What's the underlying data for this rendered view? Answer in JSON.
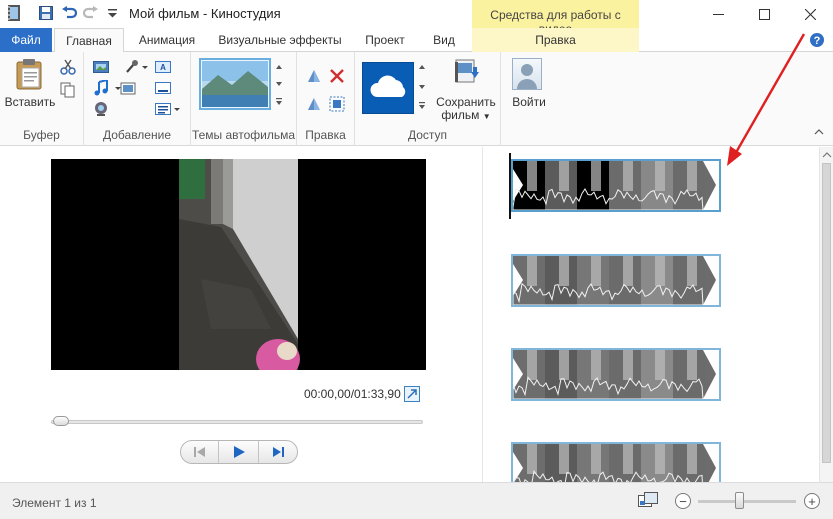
{
  "window": {
    "title": "Мой фильм - Киностудия",
    "contextual_tab_group": "Средства для работы с видео"
  },
  "tabs": [
    {
      "label": "Файл"
    },
    {
      "label": "Главная"
    },
    {
      "label": "Анимация"
    },
    {
      "label": "Визуальные эффекты"
    },
    {
      "label": "Проект"
    },
    {
      "label": "Вид"
    },
    {
      "label": "Правка"
    }
  ],
  "ribbon": {
    "clipboard": {
      "paste_label": "Вставить",
      "group_label": "Буфер"
    },
    "add": {
      "group_label": "Добавление"
    },
    "themes": {
      "group_label": "Темы автофильма"
    },
    "editing": {
      "group_label": "Правка"
    },
    "share": {
      "save_label_line1": "Сохранить",
      "save_label_line2": "фильм",
      "group_label": "Доступ"
    },
    "account": {
      "signin_label": "Войти"
    }
  },
  "player": {
    "timecode": "00:00,00/01:33,90",
    "progress_fraction": 0.0
  },
  "storyboard": {
    "clip_count": 4
  },
  "status": {
    "text": "Элемент 1 из 1",
    "zoom_fraction": 0.4
  },
  "colors": {
    "file_tab": "#2b6fc9",
    "contextual": "#fbf2a0",
    "annotation_arrow": "#e02020",
    "clip_border": "#7fb6d9"
  }
}
